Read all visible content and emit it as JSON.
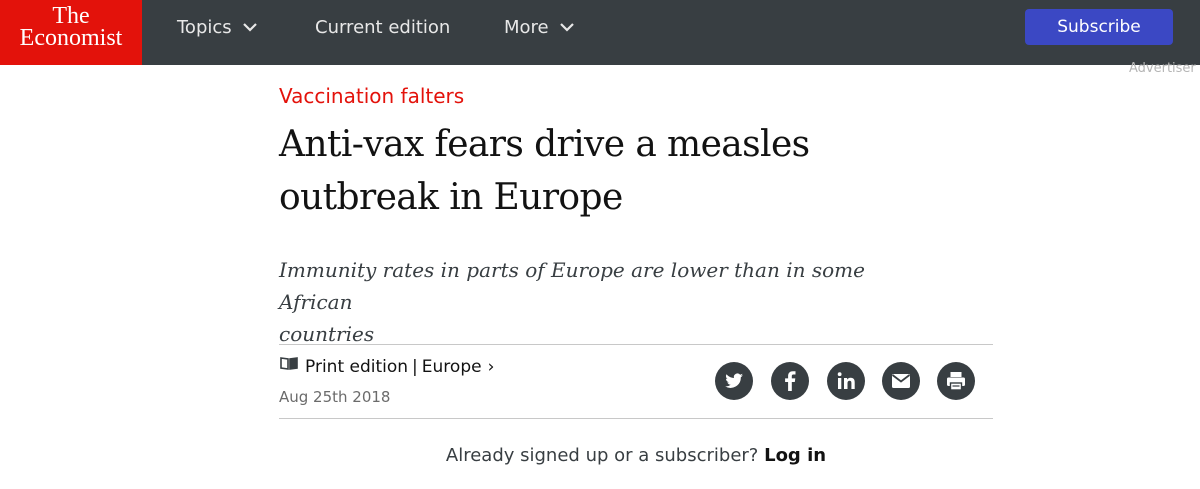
{
  "header": {
    "logo_line1": "The",
    "logo_line2": "Economist",
    "nav": {
      "topics": "Topics",
      "current_edition": "Current edition",
      "more": "More"
    },
    "subscribe_label": "Subscribe",
    "brand_color": "#e3120b",
    "bar_color": "#383e42",
    "subscribe_color": "#3b48c4"
  },
  "advertisement_label": "Advertiser",
  "article": {
    "flytitle": "Vaccination falters",
    "headline_line1": "Anti-vax fears drive a measles",
    "headline_line2": "outbreak in Europe",
    "rubric_line1": "Immunity rates in parts of Europe are lower than in some African",
    "rubric_line2": "countries",
    "print_edition": "Print edition",
    "separator": "|",
    "section": "Europe",
    "section_arrow": "›",
    "date": "Aug 25th 2018"
  },
  "share": {
    "icons": [
      "twitter-icon",
      "facebook-icon",
      "linkedin-icon",
      "email-icon",
      "print-icon"
    ]
  },
  "signup": {
    "prompt": "Already signed up or a subscriber?",
    "login_label": "Log in"
  }
}
